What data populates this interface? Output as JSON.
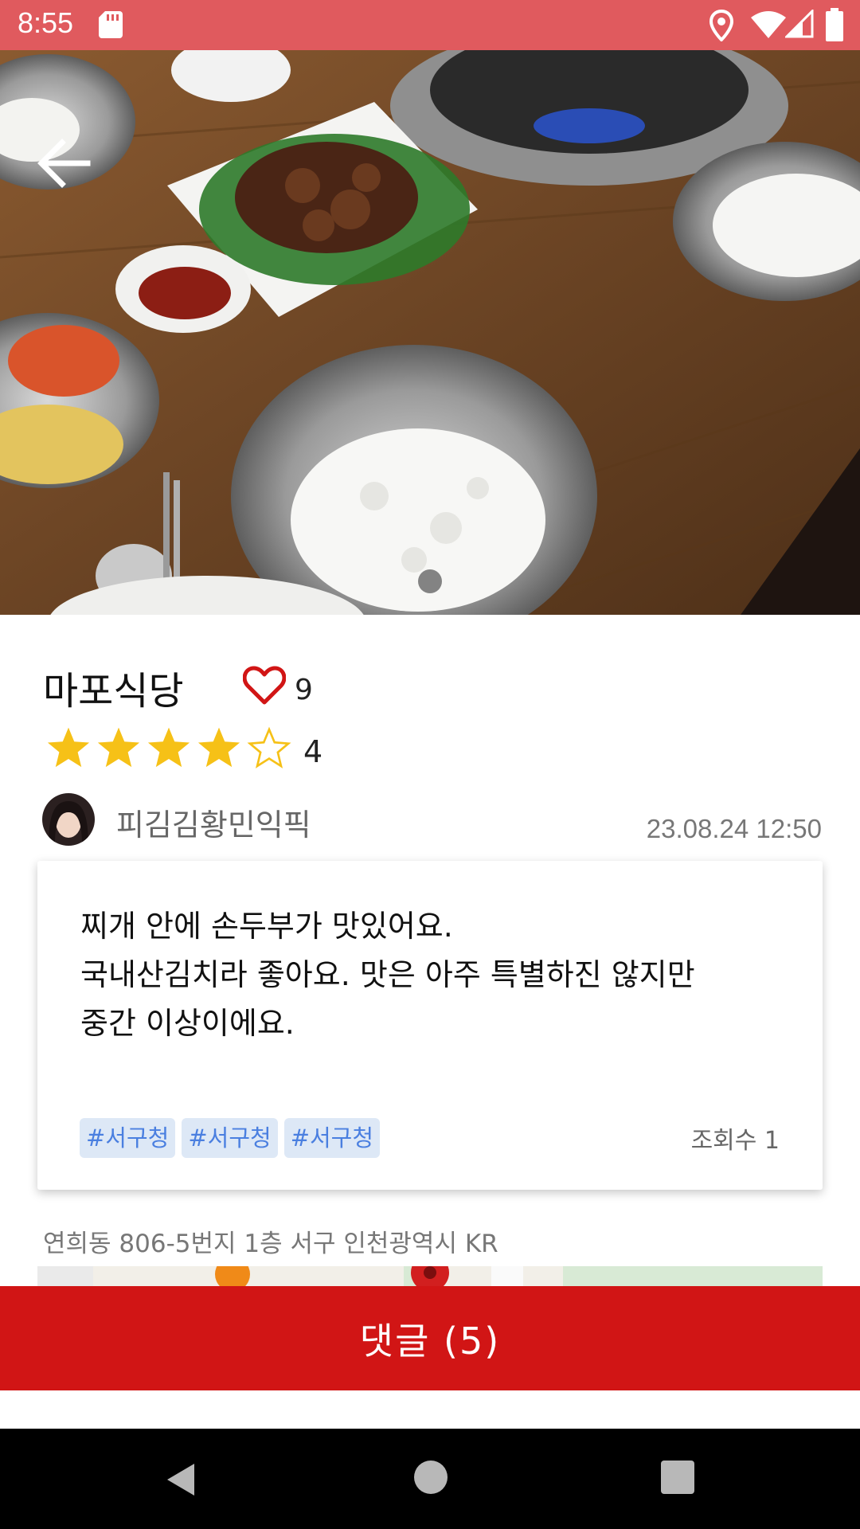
{
  "status_bar": {
    "time": "8:55",
    "icons": [
      "sd-card-icon",
      "location-icon",
      "wifi-icon",
      "signal-icon",
      "battery-icon"
    ],
    "background": "#e05a5e"
  },
  "hero": {
    "image": "food-photo",
    "back_icon": "arrow-left-icon",
    "page_indicator": {
      "count": 1,
      "active": 1
    }
  },
  "restaurant": {
    "name": "마포식당",
    "likes": "9",
    "rating": "4",
    "stars": {
      "filled": 4,
      "total": 5,
      "color": "#f6c117"
    }
  },
  "author": {
    "name": "피김김황민익픽",
    "date": "23.08.24 12:50"
  },
  "review": {
    "lines": [
      "찌개 안에 손두부가 맛있어요.",
      "국내산김치라 좋아요. 맛은 아주 특별하진 않지만",
      "중간 이상이에요."
    ],
    "tags": [
      "#서구청",
      "#서구청",
      "#서구청"
    ],
    "views": "조회수 1"
  },
  "address": "연희동 806-5번지 1층 서구 인천광역시 KR",
  "comment_button": {
    "label": "댓글 (5)",
    "color": "#d11515"
  },
  "nav": [
    "back-triangle-icon",
    "home-circle-icon",
    "recents-square-icon"
  ]
}
